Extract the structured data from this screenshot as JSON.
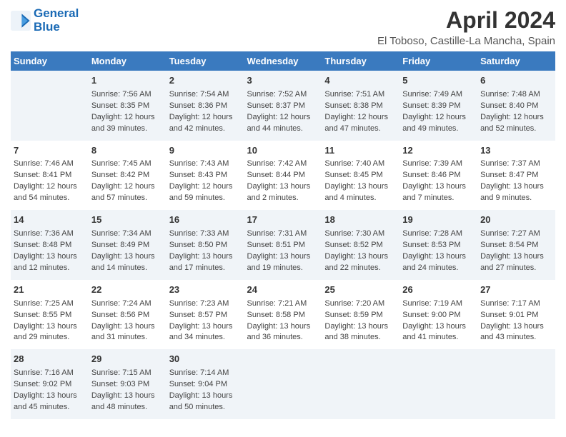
{
  "logo": {
    "line1": "General",
    "line2": "Blue"
  },
  "title": "April 2024",
  "subtitle": "El Toboso, Castille-La Mancha, Spain",
  "days_of_week": [
    "Sunday",
    "Monday",
    "Tuesday",
    "Wednesday",
    "Thursday",
    "Friday",
    "Saturday"
  ],
  "weeks": [
    [
      {
        "day": "",
        "sunrise": "",
        "sunset": "",
        "daylight": ""
      },
      {
        "day": "1",
        "sunrise": "Sunrise: 7:56 AM",
        "sunset": "Sunset: 8:35 PM",
        "daylight": "Daylight: 12 hours and 39 minutes."
      },
      {
        "day": "2",
        "sunrise": "Sunrise: 7:54 AM",
        "sunset": "Sunset: 8:36 PM",
        "daylight": "Daylight: 12 hours and 42 minutes."
      },
      {
        "day": "3",
        "sunrise": "Sunrise: 7:52 AM",
        "sunset": "Sunset: 8:37 PM",
        "daylight": "Daylight: 12 hours and 44 minutes."
      },
      {
        "day": "4",
        "sunrise": "Sunrise: 7:51 AM",
        "sunset": "Sunset: 8:38 PM",
        "daylight": "Daylight: 12 hours and 47 minutes."
      },
      {
        "day": "5",
        "sunrise": "Sunrise: 7:49 AM",
        "sunset": "Sunset: 8:39 PM",
        "daylight": "Daylight: 12 hours and 49 minutes."
      },
      {
        "day": "6",
        "sunrise": "Sunrise: 7:48 AM",
        "sunset": "Sunset: 8:40 PM",
        "daylight": "Daylight: 12 hours and 52 minutes."
      }
    ],
    [
      {
        "day": "7",
        "sunrise": "Sunrise: 7:46 AM",
        "sunset": "Sunset: 8:41 PM",
        "daylight": "Daylight: 12 hours and 54 minutes."
      },
      {
        "day": "8",
        "sunrise": "Sunrise: 7:45 AM",
        "sunset": "Sunset: 8:42 PM",
        "daylight": "Daylight: 12 hours and 57 minutes."
      },
      {
        "day": "9",
        "sunrise": "Sunrise: 7:43 AM",
        "sunset": "Sunset: 8:43 PM",
        "daylight": "Daylight: 12 hours and 59 minutes."
      },
      {
        "day": "10",
        "sunrise": "Sunrise: 7:42 AM",
        "sunset": "Sunset: 8:44 PM",
        "daylight": "Daylight: 13 hours and 2 minutes."
      },
      {
        "day": "11",
        "sunrise": "Sunrise: 7:40 AM",
        "sunset": "Sunset: 8:45 PM",
        "daylight": "Daylight: 13 hours and 4 minutes."
      },
      {
        "day": "12",
        "sunrise": "Sunrise: 7:39 AM",
        "sunset": "Sunset: 8:46 PM",
        "daylight": "Daylight: 13 hours and 7 minutes."
      },
      {
        "day": "13",
        "sunrise": "Sunrise: 7:37 AM",
        "sunset": "Sunset: 8:47 PM",
        "daylight": "Daylight: 13 hours and 9 minutes."
      }
    ],
    [
      {
        "day": "14",
        "sunrise": "Sunrise: 7:36 AM",
        "sunset": "Sunset: 8:48 PM",
        "daylight": "Daylight: 13 hours and 12 minutes."
      },
      {
        "day": "15",
        "sunrise": "Sunrise: 7:34 AM",
        "sunset": "Sunset: 8:49 PM",
        "daylight": "Daylight: 13 hours and 14 minutes."
      },
      {
        "day": "16",
        "sunrise": "Sunrise: 7:33 AM",
        "sunset": "Sunset: 8:50 PM",
        "daylight": "Daylight: 13 hours and 17 minutes."
      },
      {
        "day": "17",
        "sunrise": "Sunrise: 7:31 AM",
        "sunset": "Sunset: 8:51 PM",
        "daylight": "Daylight: 13 hours and 19 minutes."
      },
      {
        "day": "18",
        "sunrise": "Sunrise: 7:30 AM",
        "sunset": "Sunset: 8:52 PM",
        "daylight": "Daylight: 13 hours and 22 minutes."
      },
      {
        "day": "19",
        "sunrise": "Sunrise: 7:28 AM",
        "sunset": "Sunset: 8:53 PM",
        "daylight": "Daylight: 13 hours and 24 minutes."
      },
      {
        "day": "20",
        "sunrise": "Sunrise: 7:27 AM",
        "sunset": "Sunset: 8:54 PM",
        "daylight": "Daylight: 13 hours and 27 minutes."
      }
    ],
    [
      {
        "day": "21",
        "sunrise": "Sunrise: 7:25 AM",
        "sunset": "Sunset: 8:55 PM",
        "daylight": "Daylight: 13 hours and 29 minutes."
      },
      {
        "day": "22",
        "sunrise": "Sunrise: 7:24 AM",
        "sunset": "Sunset: 8:56 PM",
        "daylight": "Daylight: 13 hours and 31 minutes."
      },
      {
        "day": "23",
        "sunrise": "Sunrise: 7:23 AM",
        "sunset": "Sunset: 8:57 PM",
        "daylight": "Daylight: 13 hours and 34 minutes."
      },
      {
        "day": "24",
        "sunrise": "Sunrise: 7:21 AM",
        "sunset": "Sunset: 8:58 PM",
        "daylight": "Daylight: 13 hours and 36 minutes."
      },
      {
        "day": "25",
        "sunrise": "Sunrise: 7:20 AM",
        "sunset": "Sunset: 8:59 PM",
        "daylight": "Daylight: 13 hours and 38 minutes."
      },
      {
        "day": "26",
        "sunrise": "Sunrise: 7:19 AM",
        "sunset": "Sunset: 9:00 PM",
        "daylight": "Daylight: 13 hours and 41 minutes."
      },
      {
        "day": "27",
        "sunrise": "Sunrise: 7:17 AM",
        "sunset": "Sunset: 9:01 PM",
        "daylight": "Daylight: 13 hours and 43 minutes."
      }
    ],
    [
      {
        "day": "28",
        "sunrise": "Sunrise: 7:16 AM",
        "sunset": "Sunset: 9:02 PM",
        "daylight": "Daylight: 13 hours and 45 minutes."
      },
      {
        "day": "29",
        "sunrise": "Sunrise: 7:15 AM",
        "sunset": "Sunset: 9:03 PM",
        "daylight": "Daylight: 13 hours and 48 minutes."
      },
      {
        "day": "30",
        "sunrise": "Sunrise: 7:14 AM",
        "sunset": "Sunset: 9:04 PM",
        "daylight": "Daylight: 13 hours and 50 minutes."
      },
      {
        "day": "",
        "sunrise": "",
        "sunset": "",
        "daylight": ""
      },
      {
        "day": "",
        "sunrise": "",
        "sunset": "",
        "daylight": ""
      },
      {
        "day": "",
        "sunrise": "",
        "sunset": "",
        "daylight": ""
      },
      {
        "day": "",
        "sunrise": "",
        "sunset": "",
        "daylight": ""
      }
    ]
  ]
}
